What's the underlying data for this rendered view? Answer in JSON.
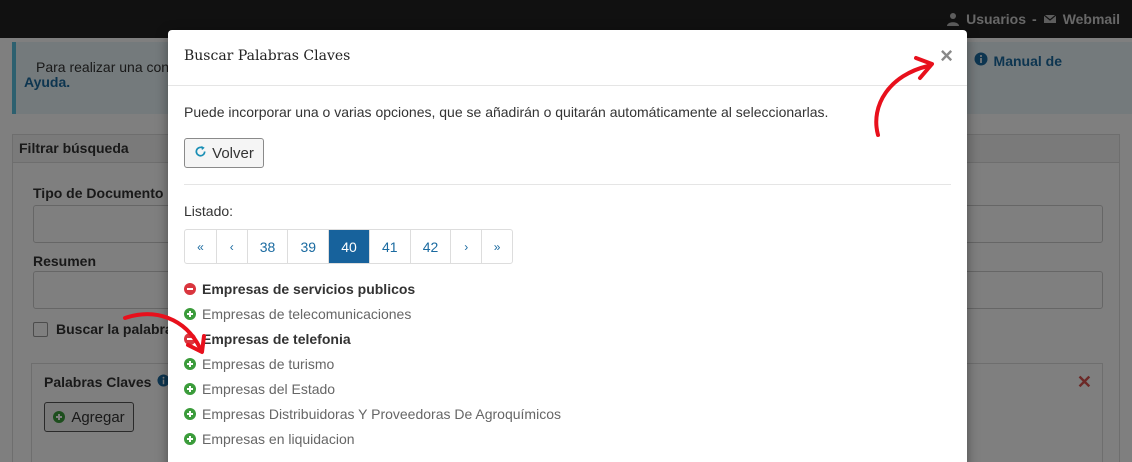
{
  "topbar": {
    "users_label": "Usuarios",
    "separator": "-",
    "webmail_label": "Webmail"
  },
  "background": {
    "alert_text": "Para realizar una cons",
    "alert_link": "Ayuda.",
    "alert_right_link": "Manual de",
    "filter_title": "Filtrar búsqueda",
    "doc_type_label": "Tipo de Documento",
    "summary_label": "Resumen",
    "checkbox_label": "Buscar la palabra/",
    "keywords_title": "Palabras Claves",
    "add_button": "Agregar"
  },
  "modal": {
    "title": "Buscar Palabras Claves",
    "close_glyph": "×",
    "intro": "Puede incorporar una o varias opciones, que se añadirán o quitarán automáticamente al seleccionarlas.",
    "back_button": "Volver",
    "list_label": "Listado:",
    "pagination": {
      "first": "«",
      "prev": "‹",
      "pages": [
        "38",
        "39",
        "40",
        "41",
        "42"
      ],
      "active": "40",
      "next": "›",
      "last": "»"
    },
    "items": [
      {
        "label": "Empresas de servicios publicos",
        "selected": true
      },
      {
        "label": "Empresas de telecomunicaciones",
        "selected": false
      },
      {
        "label": "Empresas de telefonia",
        "selected": true
      },
      {
        "label": "Empresas de turismo",
        "selected": false
      },
      {
        "label": "Empresas del Estado",
        "selected": false
      },
      {
        "label": "Empresas Distribuidoras Y Proveedoras De Agroquímicos",
        "selected": false
      },
      {
        "label": "Empresas en liquidacion",
        "selected": false
      }
    ]
  },
  "colors": {
    "primary": "#17629c",
    "remove": "#d9363e",
    "add": "#3b9c3b",
    "annotation_arrow": "#e8101c"
  }
}
